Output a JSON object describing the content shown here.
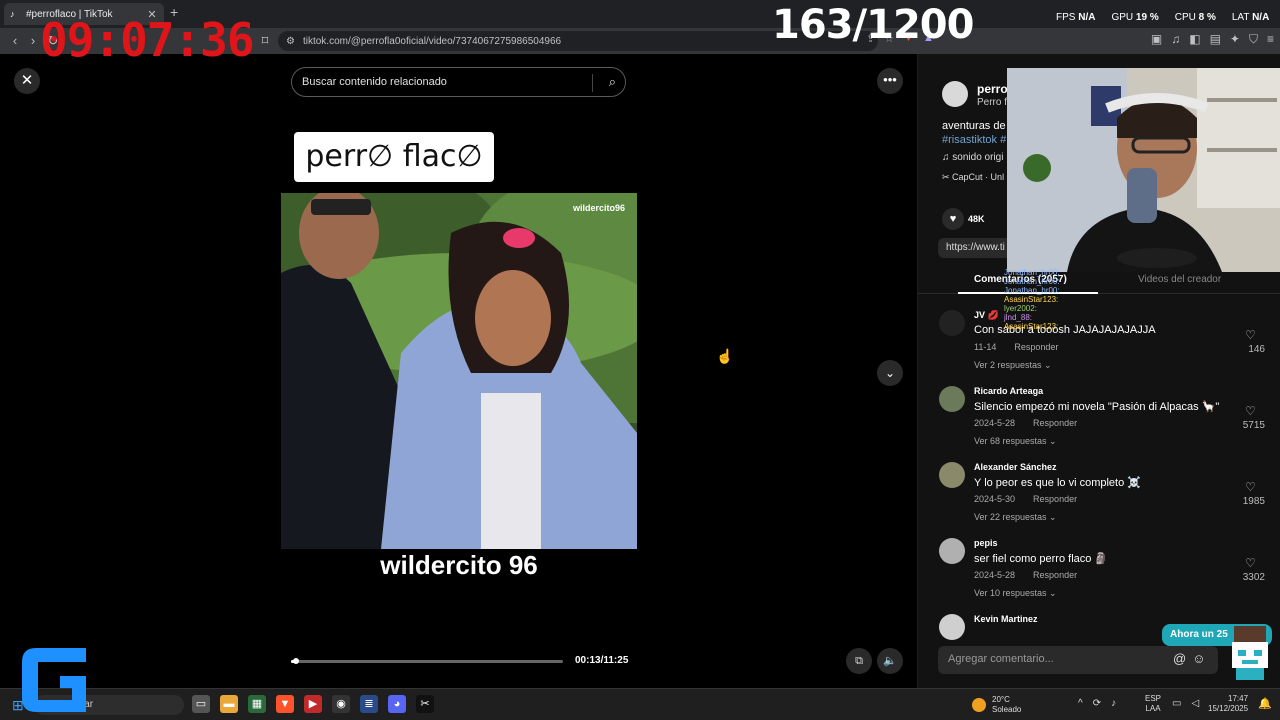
{
  "browser": {
    "tab_title": "#perroflaco | TikTok",
    "tab_close": "✕",
    "new_tab": "+",
    "url": "tiktok.com/@perrofla0oficial/video/7374067275986504966"
  },
  "overlay": {
    "clock": "09:07:36",
    "counter": "163/1200",
    "fps_label": "FPS",
    "fps_value": "N/A",
    "gpu_label": "GPU",
    "gpu_value": "19 %",
    "cpu_label": "CPU",
    "cpu_value": "8 %",
    "lat_label": "LAT",
    "lat_value": "N/A"
  },
  "video": {
    "search_placeholder": "Buscar contenido relacionado",
    "logo_text": "perr∅ flac∅",
    "watermark": "wildercito96",
    "caption": "wildercito 96",
    "time": "00:13/11:25",
    "progress": 0.02
  },
  "author": {
    "name": "perro",
    "sub": "Perro fl",
    "desc": "aventuras de",
    "hashtag": "#risastiktok #",
    "sound": "sonido origi",
    "capcut": "CapCut · Unl",
    "likes": "48K",
    "link": "https://www.ti"
  },
  "tabs": {
    "comments": "Comentarios (2057)",
    "videos": "Videos del creador"
  },
  "comments": [
    {
      "user": "JV 💋",
      "text": "Con sabor a tooosh JAJAJAJAJAJJA",
      "date": "11-14",
      "reply": "Responder",
      "replies": "Ver 2 respuestas",
      "likes": "146",
      "color": "#222222"
    },
    {
      "user": "Ricardo Arteaga",
      "text": "Silencio empezó mi novela \"Pasión di Alpacas 🦙\"",
      "date": "2024-5-28",
      "reply": "Responder",
      "replies": "Ver 68 respuestas",
      "likes": "5715",
      "color": "#6b7a5a"
    },
    {
      "user": "Alexander Sánchez",
      "text": "Y lo peor es que lo vi completo ☠️",
      "date": "2024-5-30",
      "reply": "Responder",
      "replies": "Ver 22 respuestas",
      "likes": "1985",
      "color": "#8a8a6a"
    },
    {
      "user": "pepis",
      "text": "ser fiel como perro flaco 🗿",
      "date": "2024-5-28",
      "reply": "Responder",
      "replies": "Ver 10 respuestas",
      "likes": "3302",
      "color": "#b0b0b0"
    },
    {
      "user": "Kevin Martinez",
      "text": "",
      "date": "",
      "reply": "",
      "replies": "",
      "likes": "",
      "color": "#cfcfcf"
    }
  ],
  "comment_input_placeholder": "Agregar comentario...",
  "promo": "Ahora un 25",
  "chat": [
    {
      "name": "Jonathan_hr00:",
      "color": "#8ab4f8"
    },
    {
      "name": "Jonathan_hr00:",
      "color": "#8ab4f8"
    },
    {
      "name": "Jonathan_hr00:",
      "color": "#8ab4f8"
    },
    {
      "name": "AsasinStar123:",
      "color": "#ffd54a"
    },
    {
      "name": "lyer2002:",
      "color": "#9fd36a"
    },
    {
      "name": "jlnd_88:",
      "color": "#c792ea"
    },
    {
      "name": "AsasinStar123:",
      "color": "#ffd54a"
    }
  ],
  "taskbar": {
    "search": "Buscar",
    "temp": "20°C",
    "weather": "Soleado",
    "lang1": "ESP",
    "lang2": "LAA",
    "time": "17:47",
    "date": "15/12/2025"
  },
  "colors": {
    "clock_red": "#e0151a",
    "promo_teal": "#1fa7b8",
    "hashtag_blue": "#6fa3d4",
    "gamer_blue": "#1e90ff"
  }
}
